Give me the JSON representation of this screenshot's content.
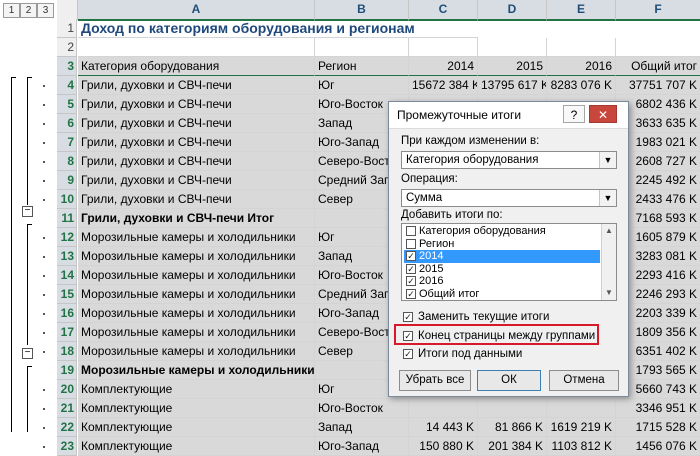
{
  "outline_levels": [
    "1",
    "2",
    "3"
  ],
  "columns": [
    "A",
    "B",
    "C",
    "D",
    "E",
    "F"
  ],
  "rows": [
    {
      "num": "1",
      "a": "Доход по категориям оборудования и регионам",
      "b": "",
      "c": "",
      "d": "",
      "e": "",
      "f": ""
    },
    {
      "num": "2",
      "a": "",
      "b": "",
      "c": "",
      "d": "",
      "e": "",
      "f": ""
    },
    {
      "num": "3",
      "a": "Категория оборудования",
      "b": "Регион",
      "c": "2014",
      "d": "2015",
      "e": "2016",
      "f": "Общий итог"
    },
    {
      "num": "4",
      "a": "Грили, духовки и СВЧ-печи",
      "b": "Юг",
      "c": "15672 384 K",
      "d": "13795 617 K",
      "e": "8283 076 K",
      "f": "37751 707 K"
    },
    {
      "num": "5",
      "a": "Грили, духовки и СВЧ-печи",
      "b": "Юго-Восток",
      "c": "",
      "d": "",
      "e": "",
      "f": "6802 436 K"
    },
    {
      "num": "6",
      "a": "Грили, духовки и СВЧ-печи",
      "b": "Запад",
      "c": "",
      "d": "",
      "e": "",
      "f": "3633 635 K"
    },
    {
      "num": "7",
      "a": "Грили, духовки и СВЧ-печи",
      "b": "Юго-Запад",
      "c": "",
      "d": "",
      "e": "",
      "f": "1983 021 K"
    },
    {
      "num": "8",
      "a": "Грили, духовки и СВЧ-печи",
      "b": "Северо-Восток",
      "c": "",
      "d": "",
      "e": "",
      "f": "2608 727 K"
    },
    {
      "num": "9",
      "a": "Грили, духовки и СВЧ-печи",
      "b": "Средний Запад",
      "c": "",
      "d": "",
      "e": "",
      "f": "2245 492 K"
    },
    {
      "num": "10",
      "a": "Грили, духовки и СВЧ-печи",
      "b": "Север",
      "c": "",
      "d": "",
      "e": "",
      "f": "2433 476 K"
    },
    {
      "num": "11",
      "a": "Грили, духовки и СВЧ-печи Итог",
      "b": "",
      "c": "",
      "d": "",
      "e": "",
      "f": "7168 593 K"
    },
    {
      "num": "12",
      "a": "Морозильные камеры и холодильники",
      "b": "Юг",
      "c": "",
      "d": "",
      "e": "",
      "f": "1605 879 K"
    },
    {
      "num": "13",
      "a": "Морозильные камеры и холодильники",
      "b": "Запад",
      "c": "",
      "d": "",
      "e": "",
      "f": "3283 081 K"
    },
    {
      "num": "14",
      "a": "Морозильные камеры и холодильники",
      "b": "Юго-Восток",
      "c": "",
      "d": "",
      "e": "",
      "f": "2293 416 K"
    },
    {
      "num": "15",
      "a": "Морозильные камеры и холодильники",
      "b": "Средний Запад",
      "c": "",
      "d": "",
      "e": "",
      "f": "2246 293 K"
    },
    {
      "num": "16",
      "a": "Морозильные камеры и холодильники",
      "b": "Юго-Запад",
      "c": "",
      "d": "",
      "e": "",
      "f": "2203 339 K"
    },
    {
      "num": "17",
      "a": "Морозильные камеры и холодильники",
      "b": "Северо-Восток",
      "c": "",
      "d": "",
      "e": "",
      "f": "1809 356 K"
    },
    {
      "num": "18",
      "a": "Морозильные камеры и холодильники",
      "b": "Север",
      "c": "",
      "d": "",
      "e": "",
      "f": "6351 402 K"
    },
    {
      "num": "19",
      "a": "Морозильные камеры и холодильники Итог",
      "b": "",
      "c": "",
      "d": "",
      "e": "",
      "f": "1793 565 K"
    },
    {
      "num": "20",
      "a": "Комплектующие",
      "b": "Юг",
      "c": "",
      "d": "",
      "e": "",
      "f": "5660 743 K"
    },
    {
      "num": "21",
      "a": "Комплектующие",
      "b": "Юго-Восток",
      "c": "",
      "d": "",
      "e": "",
      "f": "3346 951 K"
    },
    {
      "num": "22",
      "a": "Комплектующие",
      "b": "Запад",
      "c": "14 443 K",
      "d": "81 866 K",
      "e": "1619 219 K",
      "f": "1715 528 K"
    },
    {
      "num": "23",
      "a": "Комплектующие",
      "b": "Юго-Запад",
      "c": "150 880 K",
      "d": "201 384 K",
      "e": "1103 812 K",
      "f": "1456 076 K"
    }
  ],
  "dialog": {
    "title": "Промежуточные итоги",
    "help_label": "?",
    "close_label": "✕",
    "change_label": "При каждом изменении в:",
    "change_value": "Категория оборудования",
    "operation_label": "Операция:",
    "operation_value": "Сумма",
    "add_totals_label": "Добавить итоги по:",
    "list_items": [
      {
        "label": "Категория оборудования",
        "checked": false,
        "highlight": false
      },
      {
        "label": "Регион",
        "checked": false,
        "highlight": false
      },
      {
        "label": "2014",
        "checked": true,
        "highlight": true
      },
      {
        "label": "2015",
        "checked": true,
        "highlight": false
      },
      {
        "label": "2016",
        "checked": true,
        "highlight": false
      },
      {
        "label": "Общий итог",
        "checked": true,
        "highlight": false
      }
    ],
    "replace_label": "Заменить текущие итоги",
    "page_break_label": "Конец страницы между группами",
    "summary_below_label": "Итоги под данными",
    "remove_all_label": "Убрать все",
    "ok_label": "ОК",
    "cancel_label": "Отмена"
  },
  "colors": {
    "highlight_border": "#d8192a",
    "selection": "#3399ff",
    "grid_green": "#217346"
  }
}
